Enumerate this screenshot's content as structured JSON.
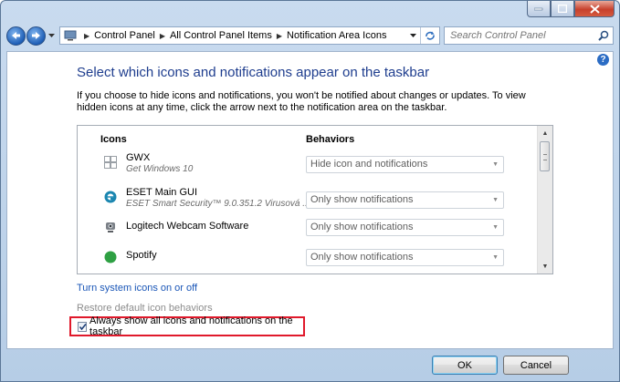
{
  "colors": {
    "heading": "#1e3d8e",
    "link": "#1a56b7",
    "highlight": "#e0192b",
    "window_frame": "#b9cfe8"
  },
  "nav": {
    "back_icon": "back-arrow-icon",
    "forward_icon": "forward-arrow-icon",
    "breadcrumbs": [
      "Control Panel",
      "All Control Panel Items",
      "Notification Area Icons"
    ],
    "search_placeholder": "Search Control Panel"
  },
  "main": {
    "heading": "Select which icons and notifications appear on the taskbar",
    "description": "If you choose to hide icons and notifications, you won't be notified about changes or updates. To view hidden icons at any time, click the arrow next to the notification area on the taskbar."
  },
  "table": {
    "col_icons": "Icons",
    "col_behaviors": "Behaviors",
    "rows": [
      {
        "name": "GWX",
        "sub": "Get Windows 10",
        "behavior": "Hide icon and notifications",
        "icon": "windows-logo-icon"
      },
      {
        "name": "ESET Main GUI",
        "sub": "ESET Smart Security™ 9.0.351.2 Virusová ...",
        "behavior": "Only show notifications",
        "icon": "eset-icon"
      },
      {
        "name": "Logitech Webcam Software",
        "sub": "",
        "behavior": "Only show notifications",
        "icon": "webcam-icon"
      },
      {
        "name": "Spotify",
        "sub": "",
        "behavior": "Only show notifications",
        "icon": "spotify-icon"
      }
    ]
  },
  "links": {
    "system_icons": "Turn system icons on or off",
    "restore": "Restore default icon behaviors"
  },
  "checkbox": {
    "label": "Always show all icons and notifications on the taskbar",
    "checked": true
  },
  "buttons": {
    "ok": "OK",
    "cancel": "Cancel"
  }
}
